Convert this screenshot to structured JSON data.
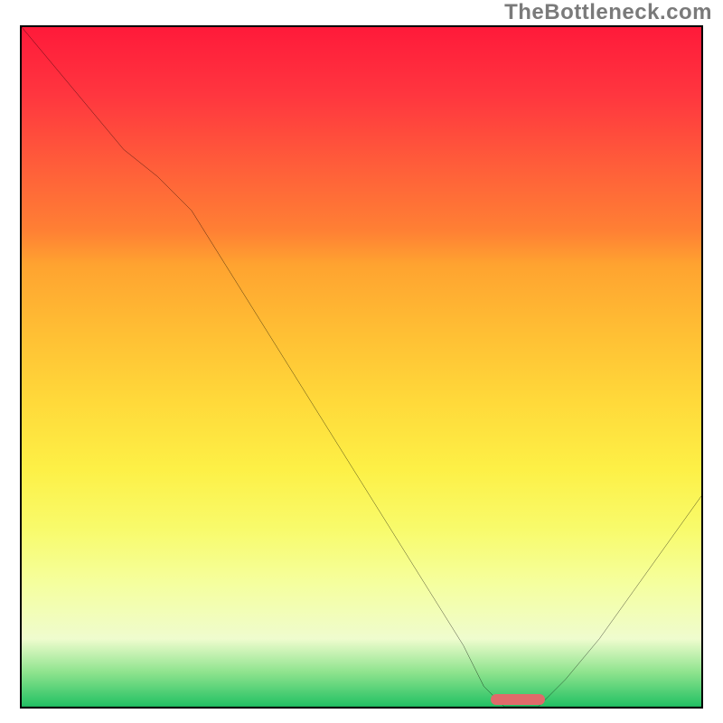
{
  "watermark": "TheBottleneck.com",
  "colors": {
    "curve_stroke": "#000000",
    "marker": "#e06a6a",
    "gradient_top": "#ff1a3a",
    "gradient_bottom": "#21c063"
  },
  "chart_data": {
    "type": "line",
    "title": "",
    "xlabel": "",
    "ylabel": "",
    "xlim": [
      0,
      100
    ],
    "ylim": [
      0,
      100
    ],
    "x": [
      0,
      5,
      10,
      15,
      20,
      25,
      30,
      35,
      40,
      45,
      50,
      55,
      60,
      65,
      68,
      71,
      73,
      76,
      80,
      85,
      90,
      95,
      100
    ],
    "values": [
      100,
      94,
      88,
      82,
      78,
      73,
      65,
      57,
      49,
      41,
      33,
      25,
      17,
      9,
      3,
      0,
      0,
      0,
      4,
      10,
      17,
      24,
      31
    ],
    "minimum_marker": {
      "x_start": 69,
      "x_end": 77,
      "y": 0
    }
  }
}
